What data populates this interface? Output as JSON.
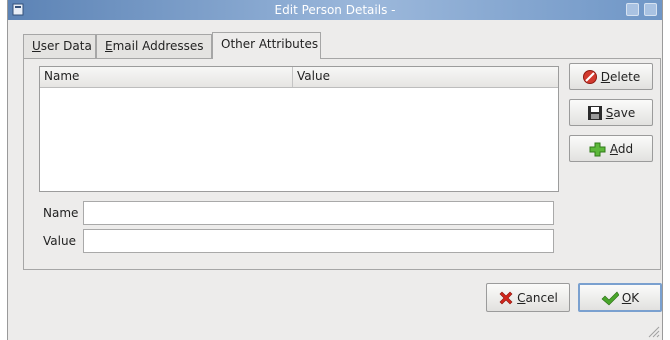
{
  "window": {
    "title": "Edit Person Details -"
  },
  "tabs": [
    {
      "label": "User Data",
      "underline": "U",
      "rest": "ser Data"
    },
    {
      "label": "Email Addresses",
      "underline": "E",
      "rest": "mail Addresses"
    },
    {
      "label": "Other Attributes"
    }
  ],
  "table": {
    "columns": [
      "Name",
      "Value"
    ],
    "rows": []
  },
  "actions": {
    "delete": {
      "label": "Delete",
      "mnemonic": "D",
      "rest": "elete"
    },
    "save": {
      "label": "Save",
      "mnemonic": "S",
      "rest": "ave"
    },
    "add": {
      "label": "Add",
      "mnemonic": "A",
      "rest": "dd"
    }
  },
  "form": {
    "name_label": "Name",
    "name_value": "",
    "value_label": "Value",
    "value_value": ""
  },
  "footer": {
    "cancel": {
      "label": "Cancel",
      "mnemonic": "C",
      "rest": "ancel"
    },
    "ok": {
      "label": "OK",
      "mnemonic": "O",
      "rest": "K"
    }
  },
  "colors": {
    "titlebar": "#6f96c6",
    "delete_icon": "#d23a2e",
    "add_icon": "#5cb83a",
    "cancel_icon": "#d2261c",
    "ok_icon": "#49a52b"
  },
  "icons": [
    "window-menu-icon",
    "delete-icon",
    "save-icon",
    "add-icon",
    "cancel-icon",
    "ok-icon",
    "resize-grip-icon"
  ]
}
